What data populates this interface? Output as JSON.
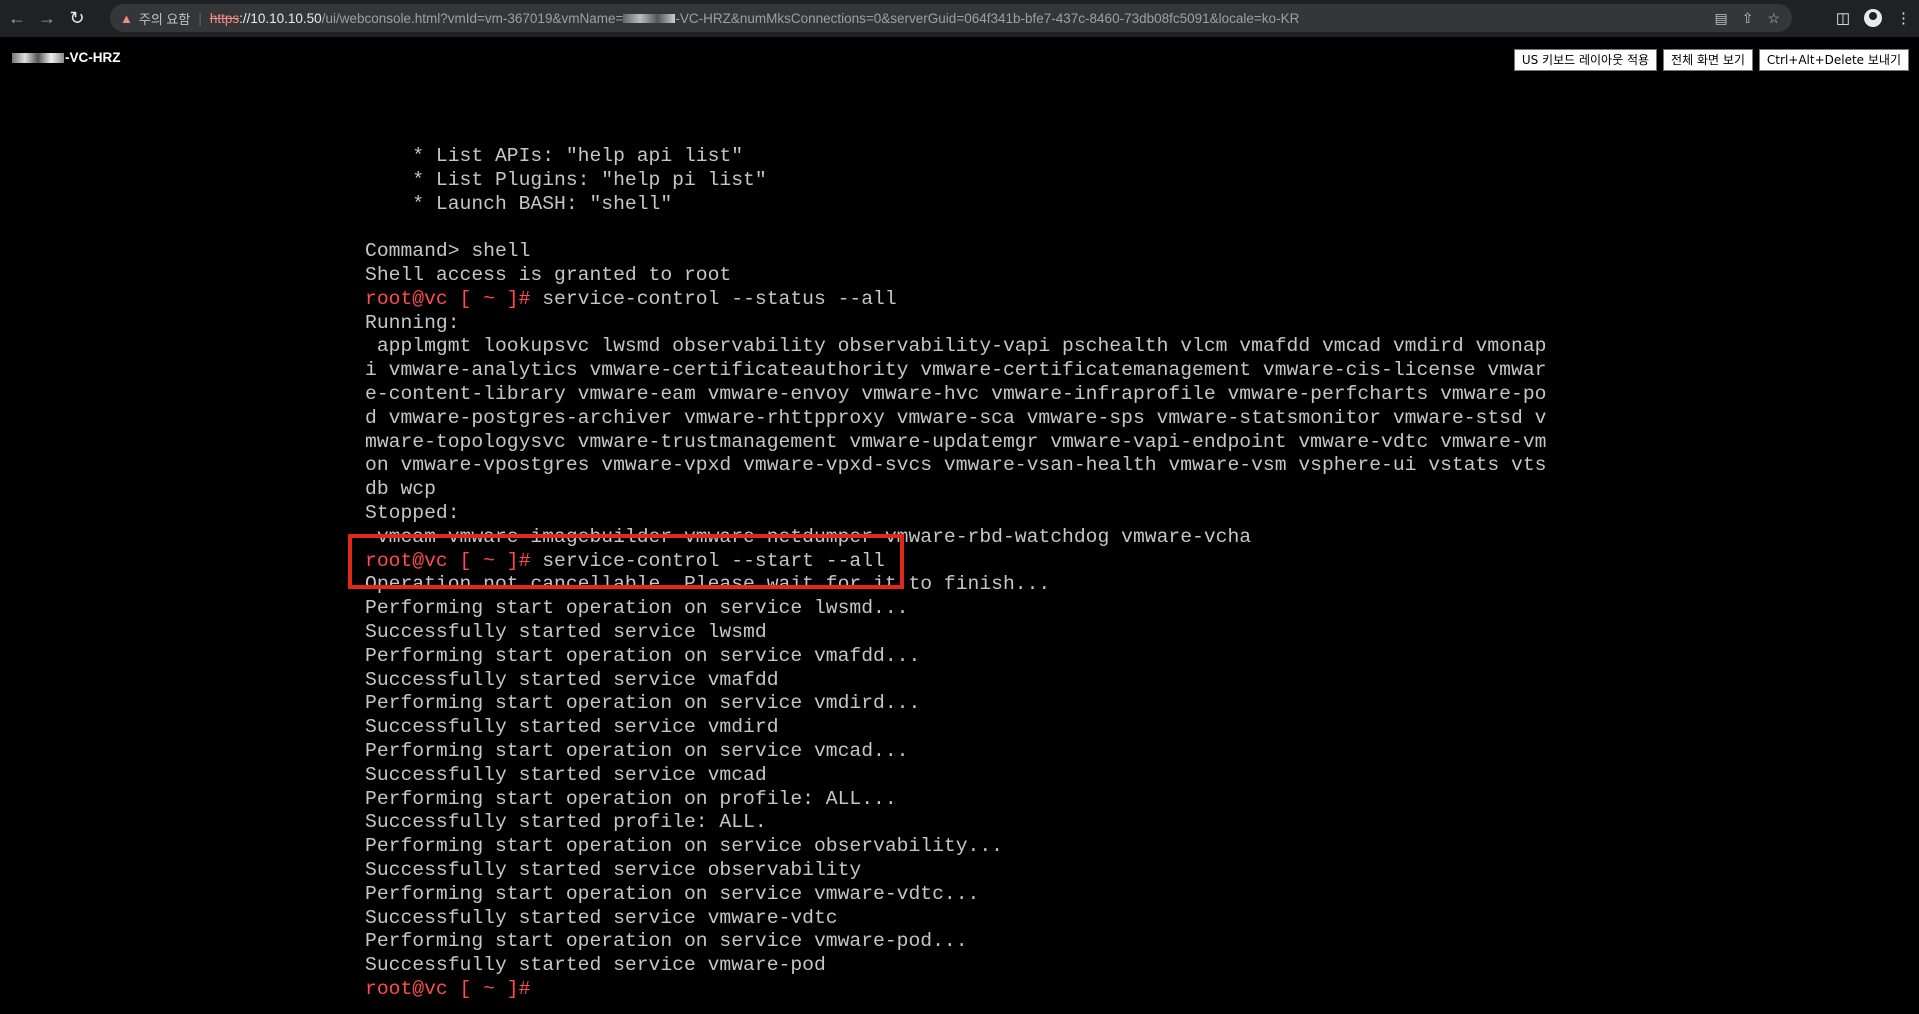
{
  "browser": {
    "back_icon": "arrow-left-icon",
    "forward_icon": "arrow-right-icon",
    "reload_icon": "reload-icon",
    "security_warning": "주의 요함",
    "url_scheme": "https",
    "url_host": "://10.10.10.50",
    "url_path": "/ui/webconsole.html?vmId=vm-367019&vmName=",
    "url_path_rest": "-VC-HRZ&numMksConnections=0&serverGuid=064f341b-bfe7-437c-8460-73db08fc5091&locale=ko-KR"
  },
  "console_header": {
    "vm_name": "-VC-HRZ",
    "buttons": {
      "us_keyboard": "US 키보드 레이아웃 적용",
      "fullscreen": "전체 화면 보기",
      "ctrl_alt_del": "Ctrl+Alt+Delete 보내기"
    }
  },
  "terminal": {
    "prompt": "root@vc [ ~ ]#",
    "lines": [
      {
        "text": "    * List APIs: \"help api list\""
      },
      {
        "text": "    * List Plugins: \"help pi list\""
      },
      {
        "text": "    * Launch BASH: \"shell\""
      },
      {
        "text": ""
      },
      {
        "text": "Command> shell"
      },
      {
        "text": "Shell access is granted to root"
      },
      {
        "prompt": true,
        "text": " service-control --status --all"
      },
      {
        "text": "Running:"
      },
      {
        "text": " applmgmt lookupsvc lwsmd observability observability-vapi pschealth vlcm vmafdd vmcad vmdird vmonap"
      },
      {
        "text": "i vmware-analytics vmware-certificateauthority vmware-certificatemanagement vmware-cis-license vmwar"
      },
      {
        "text": "e-content-library vmware-eam vmware-envoy vmware-hvc vmware-infraprofile vmware-perfcharts vmware-po"
      },
      {
        "text": "d vmware-postgres-archiver vmware-rhttpproxy vmware-sca vmware-sps vmware-statsmonitor vmware-stsd v"
      },
      {
        "text": "mware-topologysvc vmware-trustmanagement vmware-updatemgr vmware-vapi-endpoint vmware-vdtc vmware-vm"
      },
      {
        "text": "on vmware-vpostgres vmware-vpxd vmware-vpxd-svcs vmware-vsan-health vmware-vsm vsphere-ui vstats vts"
      },
      {
        "text": "db wcp"
      },
      {
        "text": "Stopped:"
      },
      {
        "text": " vmcam vmware-imagebuilder vmware-netdumper vmware-rbd-watchdog vmware-vcha"
      },
      {
        "prompt": true,
        "text": " service-control --start --all"
      },
      {
        "text": "Operation not cancellable. Please wait for it to finish..."
      },
      {
        "text": "Performing start operation on service lwsmd..."
      },
      {
        "text": "Successfully started service lwsmd"
      },
      {
        "text": "Performing start operation on service vmafdd..."
      },
      {
        "text": "Successfully started service vmafdd"
      },
      {
        "text": "Performing start operation on service vmdird..."
      },
      {
        "text": "Successfully started service vmdird"
      },
      {
        "text": "Performing start operation on service vmcad..."
      },
      {
        "text": "Successfully started service vmcad"
      },
      {
        "text": "Performing start operation on profile: ALL..."
      },
      {
        "text": "Successfully started profile: ALL."
      },
      {
        "text": "Performing start operation on service observability..."
      },
      {
        "text": "Successfully started service observability"
      },
      {
        "text": "Performing start operation on service vmware-vdtc..."
      },
      {
        "text": "Successfully started service vmware-vdtc"
      },
      {
        "text": "Performing start operation on service vmware-pod..."
      },
      {
        "text": "Successfully started service vmware-pod"
      },
      {
        "prompt": true,
        "text": ""
      }
    ]
  },
  "colors": {
    "terminal_text": "#c6c6c6",
    "prompt": "#ff4b4b",
    "highlight_box": "#e0291a",
    "background": "#000000"
  }
}
